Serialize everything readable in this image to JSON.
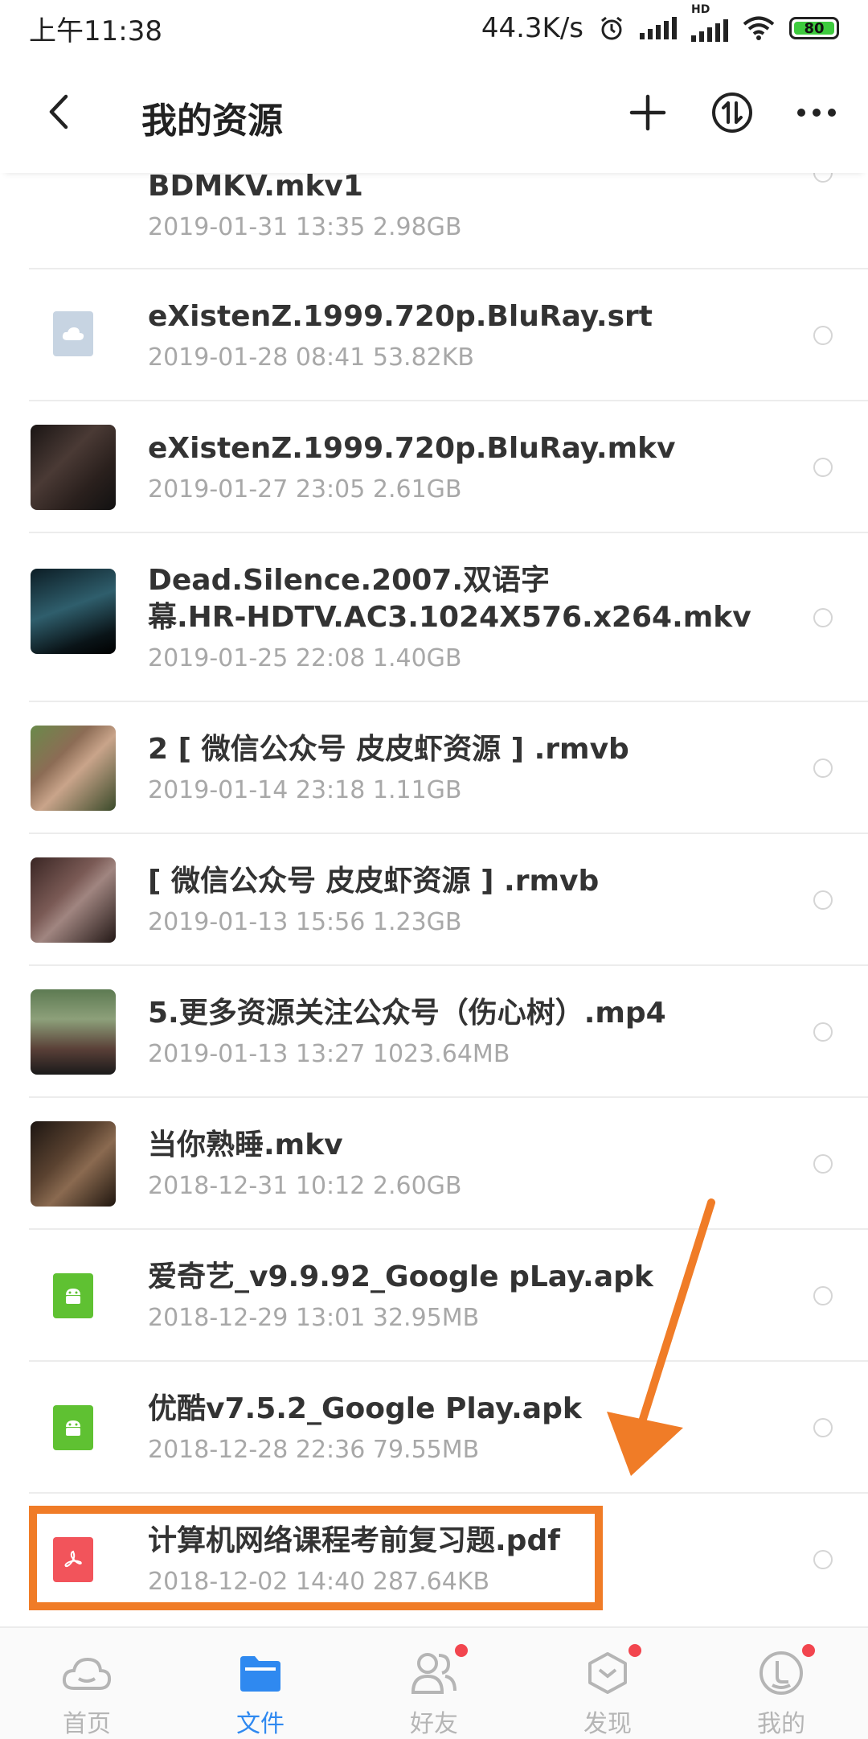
{
  "status_bar": {
    "time": "上午11:38",
    "net_speed": "44.3K/s",
    "hd_label": "HD",
    "battery": "80"
  },
  "header": {
    "title": "我的资源"
  },
  "files": [
    {
      "name": "BDMKV.mkv1",
      "meta": "2019-01-31  13:35  2.98GB",
      "icon": "video-thumbnail"
    },
    {
      "name": "eXistenZ.1999.720p.BluRay.srt",
      "meta": "2019-01-28  08:41  53.82KB",
      "icon": "cloud-file-icon"
    },
    {
      "name": "eXistenZ.1999.720p.BluRay.mkv",
      "meta": "2019-01-27  23:05  2.61GB",
      "icon": "video-thumbnail"
    },
    {
      "name": "Dead.Silence.2007.双语字\n幕.HR-HDTV.AC3.1024X576.x264.mkv",
      "meta": "2019-01-25  22:08  1.40GB",
      "icon": "video-thumbnail"
    },
    {
      "name": "2 [ 微信公众号 皮皮虾资源 ] .rmvb",
      "meta": "2019-01-14  23:18  1.11GB",
      "icon": "video-thumbnail"
    },
    {
      "name": "[ 微信公众号 皮皮虾资源 ] .rmvb",
      "meta": "2019-01-13  15:56  1.23GB",
      "icon": "video-thumbnail"
    },
    {
      "name": "5.更多资源关注公众号（伤心树）.mp4",
      "meta": "2019-01-13  13:27  1023.64MB",
      "icon": "video-thumbnail"
    },
    {
      "name": "当你熟睡.mkv",
      "meta": "2018-12-31  10:12  2.60GB",
      "icon": "video-thumbnail"
    },
    {
      "name": "爱奇艺_v9.9.92_Google pLay.apk",
      "meta": "2018-12-29  13:01  32.95MB",
      "icon": "android-apk-icon"
    },
    {
      "name": "优酷v7.5.2_Google Play.apk",
      "meta": "2018-12-28  22:36  79.55MB",
      "icon": "android-apk-icon"
    },
    {
      "name": "计算机网络课程考前复习题.pdf",
      "meta": "2018-12-02  14:40  287.64KB",
      "icon": "pdf-icon"
    }
  ],
  "bottom_nav": [
    {
      "label": "首页",
      "icon": "cloud-home-icon",
      "active": false,
      "badge": false
    },
    {
      "label": "文件",
      "icon": "folder-icon",
      "active": true,
      "badge": false
    },
    {
      "label": "好友",
      "icon": "friends-icon",
      "active": false,
      "badge": true
    },
    {
      "label": "发现",
      "icon": "discover-icon",
      "active": false,
      "badge": true
    },
    {
      "label": "我的",
      "icon": "profile-icon",
      "active": false,
      "badge": true
    }
  ],
  "colors": {
    "accent": "#2f89f0",
    "highlight": "#f07c27",
    "apk_green": "#5fc132",
    "pdf_red": "#f2545b",
    "cloud_file": "#c7d4e2"
  }
}
